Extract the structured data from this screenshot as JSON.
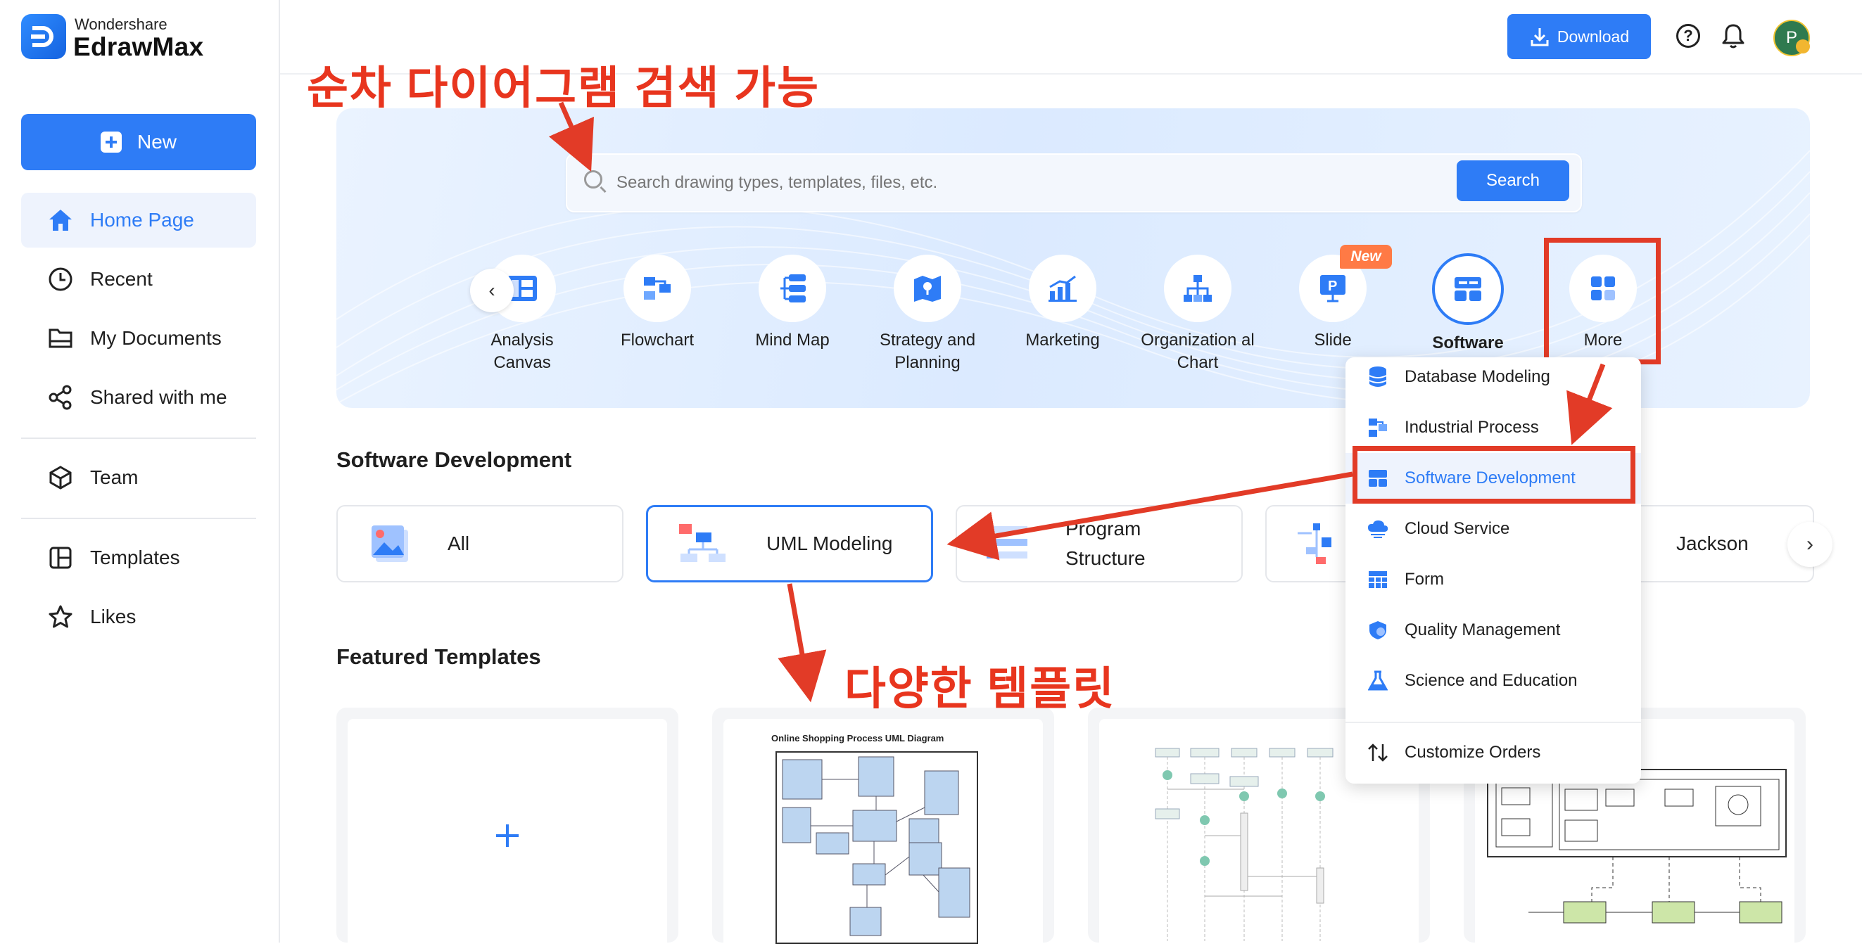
{
  "app": {
    "brand_small": "Wondershare",
    "brand_name": "EdrawMax"
  },
  "sidebar": {
    "new_label": "New",
    "items": [
      {
        "label": "Home Page",
        "icon": "home-icon"
      },
      {
        "label": "Recent",
        "icon": "clock-icon"
      },
      {
        "label": "My Documents",
        "icon": "folder-icon"
      },
      {
        "label": "Shared with me",
        "icon": "share-icon"
      },
      {
        "label": "Team",
        "icon": "cube-icon"
      },
      {
        "label": "Templates",
        "icon": "template-icon"
      },
      {
        "label": "Likes",
        "icon": "star-icon"
      }
    ]
  },
  "header": {
    "download_label": "Download",
    "avatar_initial": "P"
  },
  "search": {
    "placeholder": "Search drawing types, templates, files, etc.",
    "button_label": "Search"
  },
  "categories": [
    {
      "label": "Analysis Canvas"
    },
    {
      "label": "Flowchart"
    },
    {
      "label": "Mind Map"
    },
    {
      "label": "Strategy and Planning"
    },
    {
      "label": "Marketing"
    },
    {
      "label": "Organization al Chart"
    },
    {
      "label": "Slide",
      "badge": "New"
    },
    {
      "label": "Software"
    },
    {
      "label": "More"
    }
  ],
  "software_section": {
    "title": "Software Development",
    "tiles": [
      {
        "label": "All"
      },
      {
        "label": "UML Modeling"
      },
      {
        "label": "Program Structure"
      },
      {
        "label": ""
      },
      {
        "label": "Jackson"
      }
    ]
  },
  "featured": {
    "title": "Featured Templates",
    "card2_title": "Online Shopping Process UML Diagram"
  },
  "dropdown": {
    "items": [
      {
        "label": "Database Modeling"
      },
      {
        "label": "Industrial Process"
      },
      {
        "label": "Software Development"
      },
      {
        "label": "Cloud Service"
      },
      {
        "label": "Form"
      },
      {
        "label": "Quality Management"
      },
      {
        "label": "Science and Education"
      }
    ],
    "customize_label": "Customize Orders"
  },
  "annotations": {
    "search_note": "순차 다이어그램 검색 가능",
    "templates_note": "다양한 템플릿"
  },
  "colors": {
    "accent": "#2e7cf6",
    "annotation_red": "#e23b27",
    "new_badge": "#ff7a45"
  }
}
